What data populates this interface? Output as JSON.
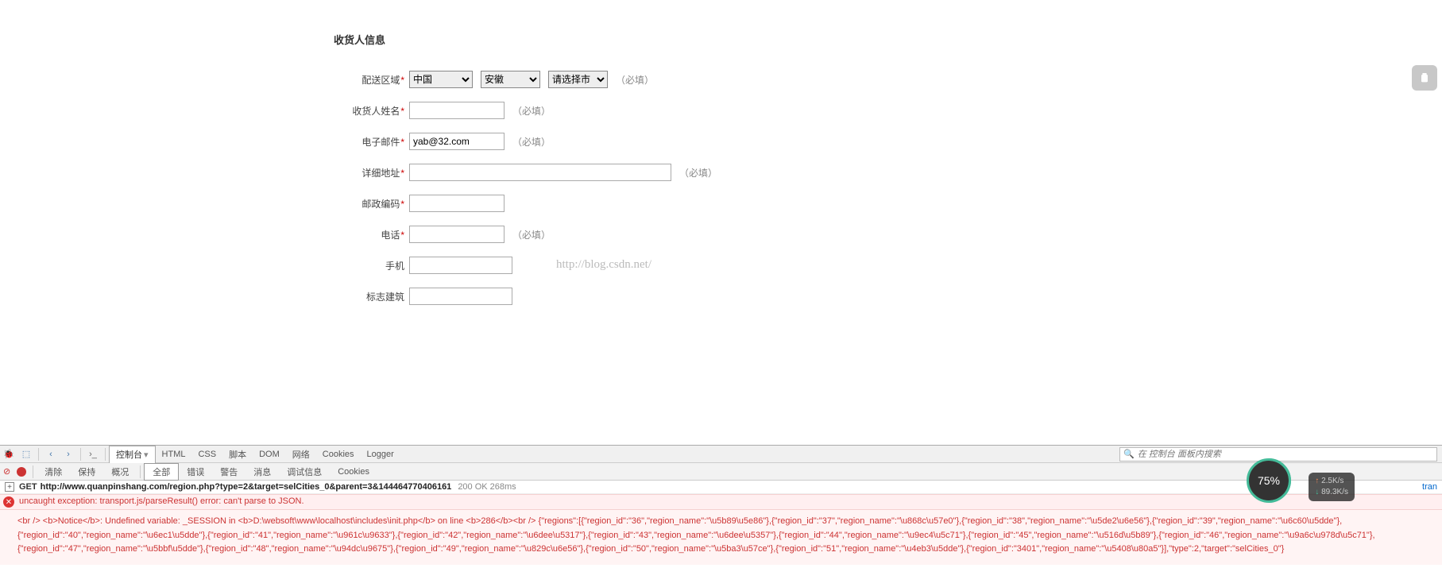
{
  "section_title": "收货人信息",
  "fields": {
    "region": {
      "label": "配送区域",
      "note": "（必填）"
    },
    "country": {
      "options": [
        "中国"
      ]
    },
    "province": {
      "options": [
        "安徽"
      ]
    },
    "city": {
      "options": [
        "请选择市"
      ]
    },
    "name": {
      "label": "收货人姓名",
      "note": "（必填）",
      "value": ""
    },
    "email": {
      "label": "电子邮件",
      "note": "（必填）",
      "value": "yab@32.com"
    },
    "address": {
      "label": "详细地址",
      "note": "（必填）",
      "value": ""
    },
    "postcode": {
      "label": "邮政编码",
      "value": ""
    },
    "phone": {
      "label": "电话",
      "note": "（必填）",
      "value": ""
    },
    "mobile": {
      "label": "手机",
      "value": ""
    },
    "landmark": {
      "label": "标志建筑",
      "value": ""
    }
  },
  "watermark": "http://blog.csdn.net/",
  "devtools": {
    "tabs_row1": [
      "控制台",
      "HTML",
      "CSS",
      "脚本",
      "DOM",
      "网络",
      "Cookies",
      "Logger"
    ],
    "active_tab": "控制台",
    "search_placeholder": "在 控制台 面板内搜索",
    "filters": [
      "清除",
      "保持",
      "概况",
      "全部",
      "错误",
      "警告",
      "消息",
      "调试信息",
      "Cookies"
    ],
    "active_filter": "全部"
  },
  "console": {
    "request": {
      "method": "GET",
      "url": "http://www.quanpinshang.com/region.php?type=2&target=selCities_0&parent=3&144464770406161",
      "status": "200 OK 268ms",
      "trail": "tran"
    },
    "error_summary": "uncaught exception: transport.js/parseResult() error: can't parse to JSON.",
    "error_body": "<br />\n<b>Notice</b>:  Undefined variable: _SESSION in <b>D:\\websoft\\www\\localhost\\includes\\init.php</b> on line <b>286</b><br />\n{\"regions\":[{\"region_id\":\"36\",\"region_name\":\"\\u5b89\\u5e86\"},{\"region_id\":\"37\",\"region_name\":\"\\u868c\\u57e0\"},{\"region_id\":\"38\",\"region_name\":\"\\u5de2\\u6e56\"},{\"region_id\":\"39\",\"region_name\":\"\\u6c60\\u5dde\"},{\"region_id\":\"40\",\"region_name\":\"\\u6ec1\\u5dde\"},{\"region_id\":\"41\",\"region_name\":\"\\u961c\\u9633\"},{\"region_id\":\"42\",\"region_name\":\"\\u6dee\\u5317\"},{\"region_id\":\"43\",\"region_name\":\"\\u6dee\\u5357\"},{\"region_id\":\"44\",\"region_name\":\"\\u9ec4\\u5c71\"},{\"region_id\":\"45\",\"region_name\":\"\\u516d\\u5b89\"},{\"region_id\":\"46\",\"region_name\":\"\\u9a6c\\u978d\\u5c71\"},{\"region_id\":\"47\",\"region_name\":\"\\u5bbf\\u5dde\"},{\"region_id\":\"48\",\"region_name\":\"\\u94dc\\u9675\"},{\"region_id\":\"49\",\"region_name\":\"\\u829c\\u6e56\"},{\"region_id\":\"50\",\"region_name\":\"\\u5ba3\\u57ce\"},{\"region_id\":\"51\",\"region_name\":\"\\u4eb3\\u5dde\"},{\"region_id\":\"3401\",\"region_name\":\"\\u5408\\u80a5\"}],\"type\":2,\"target\":\"selCities_0\"}"
  },
  "netmon": {
    "percent": "75%",
    "up": "2.5K/s",
    "down": "89.3K/s"
  }
}
